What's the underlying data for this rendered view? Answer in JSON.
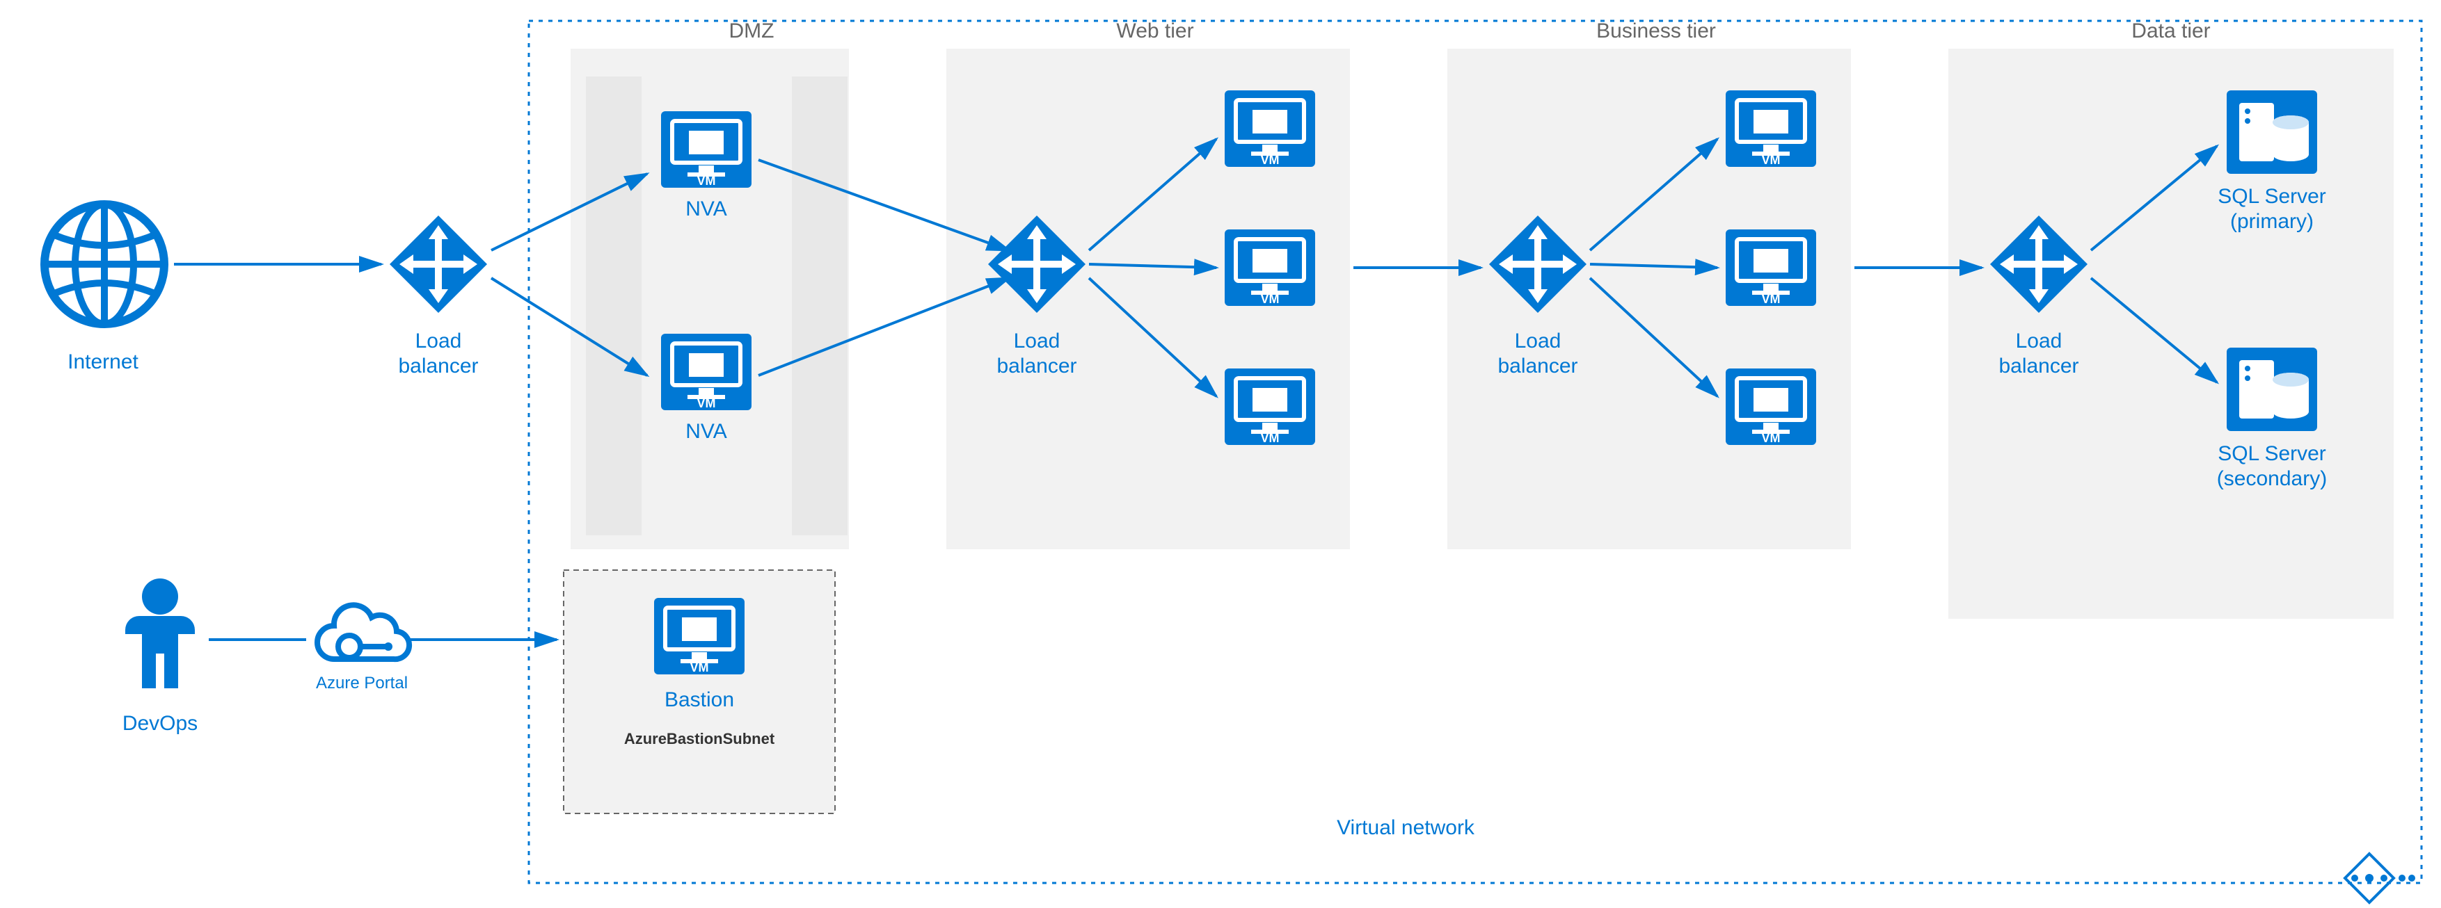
{
  "labels": {
    "internet": "Internet",
    "devops": "DevOps",
    "azure_portal": "Azure Portal",
    "load_balancer": "Load\nbalancer",
    "dmz": "DMZ",
    "web": "Web tier",
    "business": "Business tier",
    "data": "Data tier",
    "nva": "NVA",
    "bastion": "Bastion",
    "bastion_subnet": "AzureBastionSubnet",
    "vnet": "Virtual network",
    "sql_primary_1": "SQL Server",
    "sql_primary_2": "(primary)",
    "sql_secondary_1": "SQL Server",
    "sql_secondary_2": "(secondary)",
    "vm": "VM"
  },
  "colors": {
    "azure": "#0078d4",
    "azure_dark": "#005a9e",
    "grey": "#f2f2f2",
    "grey2": "#e8e8e8"
  }
}
